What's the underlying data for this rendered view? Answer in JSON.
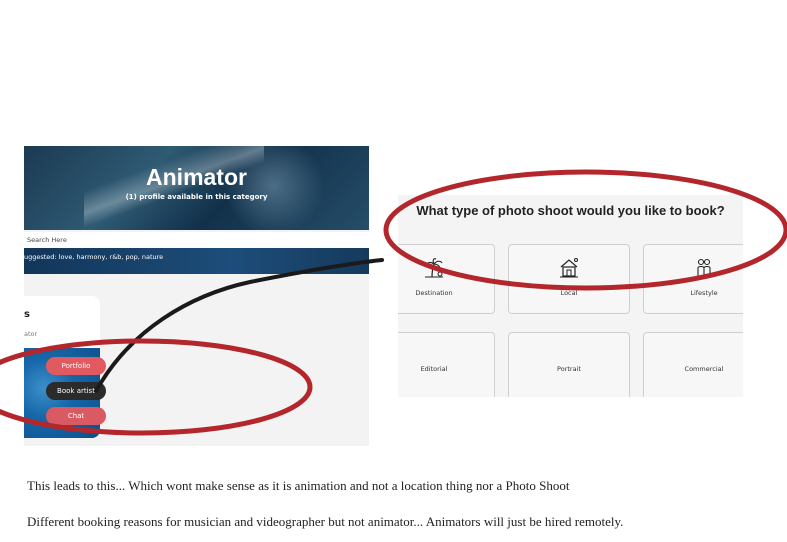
{
  "left": {
    "hero_title": "Animator",
    "hero_subtitle": "(1) profile available in this category",
    "search_placeholder": "Search Here",
    "suggested": "uggested: love, harmony, r&b, pop, nature",
    "card_name": "s",
    "card_role": "ator",
    "buttons": {
      "portfolio": "Portfolio",
      "book": "Book artist",
      "chat": "Chat"
    }
  },
  "right": {
    "question": "What type of photo shoot would you like to book?",
    "options": [
      {
        "label": "Destination",
        "icon": "palm-tree-icon"
      },
      {
        "label": "Local",
        "icon": "house-icon"
      },
      {
        "label": "Lifestyle",
        "icon": "people-icon"
      },
      {
        "label": "Editorial",
        "icon": ""
      },
      {
        "label": "Portrait",
        "icon": ""
      },
      {
        "label": "Commercial",
        "icon": ""
      }
    ]
  },
  "annotation_color": "#b3262b",
  "captions": {
    "line1": "This leads to this... Which wont make sense as it is animation and not a location thing nor a Photo Shoot",
    "line2": "Different booking reasons for  musician and videographer but not animator... Animators will just be hired remotely."
  }
}
